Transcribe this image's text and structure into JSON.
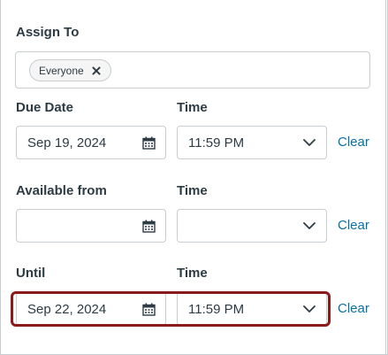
{
  "assign": {
    "label": "Assign To",
    "pill_label": "Everyone"
  },
  "due": {
    "date_label": "Due Date",
    "time_label": "Time",
    "date_value": "Sep 19, 2024",
    "time_value": "11:59 PM",
    "clear_label": "Clear"
  },
  "available": {
    "date_label": "Available from",
    "time_label": "Time",
    "date_value": "",
    "time_value": "",
    "clear_label": "Clear"
  },
  "until": {
    "date_label": "Until",
    "time_label": "Time",
    "date_value": "Sep 22, 2024",
    "time_value": "11:59 PM",
    "clear_label": "Clear"
  },
  "colors": {
    "link": "#0770a3",
    "highlight_border": "#8b1a1a",
    "field_border": "#c7cdd1",
    "text": "#2d3b45"
  },
  "icons": {
    "calendar": "calendar-icon",
    "chevron": "chevron-down-icon",
    "remove": "close-icon"
  }
}
